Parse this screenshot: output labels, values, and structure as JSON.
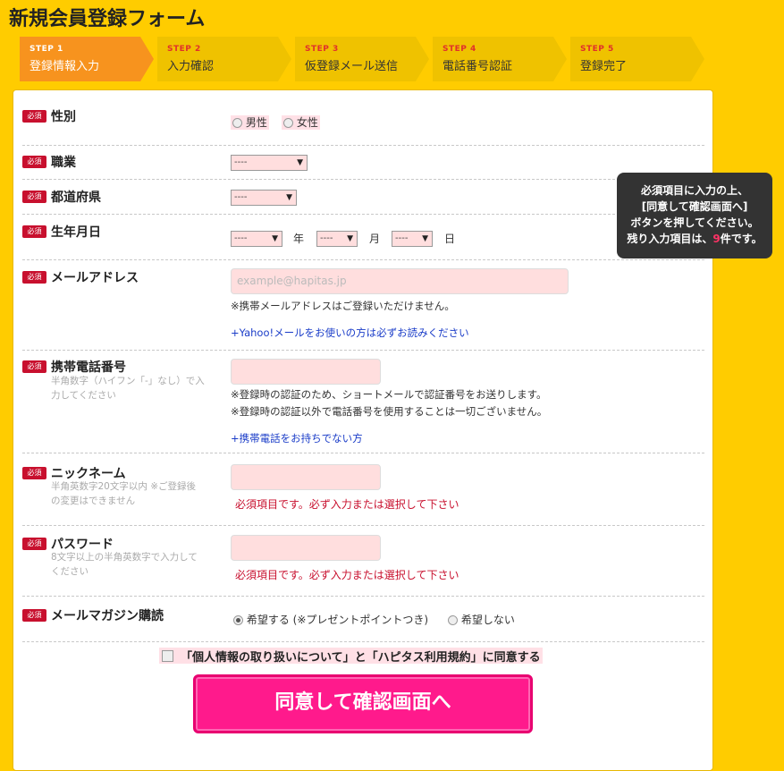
{
  "page_title": "新規会員登録フォーム",
  "steps": [
    {
      "num": "STEP 1",
      "label": "登録情報入力",
      "color": "#f7931e"
    },
    {
      "num": "STEP 2",
      "label": "入力確認",
      "color": "#efc200"
    },
    {
      "num": "STEP 3",
      "label": "仮登録メール送信",
      "color": "#efc200"
    },
    {
      "num": "STEP 4",
      "label": "電話番号認証",
      "color": "#efc200"
    },
    {
      "num": "STEP 5",
      "label": "登録完了",
      "color": "#efc200"
    }
  ],
  "required_badge": "必須",
  "gender": {
    "label": "性別",
    "options": [
      "男性",
      "女性"
    ]
  },
  "occupation": {
    "label": "職業",
    "value": "----"
  },
  "prefecture": {
    "label": "都道府県",
    "value": "----"
  },
  "birthday": {
    "label": "生年月日",
    "year": "----",
    "year_unit": "年",
    "month": "----",
    "month_unit": "月",
    "day": "----",
    "day_unit": "日"
  },
  "email": {
    "label": "メールアドレス",
    "placeholder": "example@hapitas.jp",
    "note": "※携帯メールアドレスはご登録いただけません。",
    "link": "+Yahoo!メールをお使いの方は必ずお読みください"
  },
  "phone": {
    "label": "携帯電話番号",
    "sub": "半角数字（ハイフン「-」なし）で入力してください",
    "note1": "※登録時の認証のため、ショートメールで認証番号をお送りします。",
    "note2": "※登録時の認証以外で電話番号を使用することは一切ございません。",
    "link": "+携帯電話をお持ちでない方"
  },
  "nickname": {
    "label": "ニックネーム",
    "sub": "半角英数字20文字以内 ※ご登録後の変更はできません",
    "error": "必須項目です。必ず入力または選択して下さい"
  },
  "password": {
    "label": "パスワード",
    "sub": "8文字以上の半角英数字で入力してください",
    "error": "必須項目です。必ず入力または選択して下さい"
  },
  "newsletter": {
    "label": "メールマガジン購読",
    "options": [
      "希望する (※プレゼントポイントつき)",
      "希望しない"
    ],
    "selected": 0
  },
  "tooltip": {
    "line1": "必須項目に入力の上、",
    "line2": "[同意して確認画面へ]",
    "line3": "ボタンを押してください。",
    "line4_pre": "残り入力項目は、",
    "remaining": "9",
    "line4_post": "件です。"
  },
  "agreement": "「個人情報の取り扱いについて」と「ハピタス利用規約」に同意する",
  "submit_label": "同意して確認画面へ"
}
